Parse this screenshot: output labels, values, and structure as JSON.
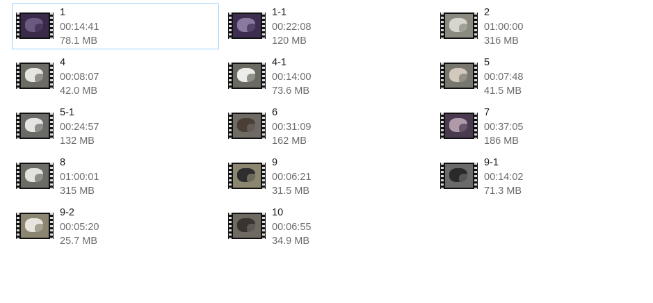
{
  "items": [
    {
      "name": "1",
      "duration": "00:14:41",
      "size": "78.1 MB",
      "selected": true,
      "thumb_bg": "#3a2a4a",
      "thumb_fg": "#6b5a7f"
    },
    {
      "name": "1-1",
      "duration": "00:22:08",
      "size": "120 MB",
      "selected": false,
      "thumb_bg": "#3d2d4f",
      "thumb_fg": "#8a7aa0"
    },
    {
      "name": "2",
      "duration": "01:00:00",
      "size": "316 MB",
      "selected": false,
      "thumb_bg": "#8a8a80",
      "thumb_fg": "#d8d6cc"
    },
    {
      "name": "4",
      "duration": "00:08:07",
      "size": "42.0 MB",
      "selected": false,
      "thumb_bg": "#6c6c64",
      "thumb_fg": "#e6e6e0"
    },
    {
      "name": "4-1",
      "duration": "00:14:00",
      "size": "73.6 MB",
      "selected": false,
      "thumb_bg": "#6a6a62",
      "thumb_fg": "#ececea"
    },
    {
      "name": "5",
      "duration": "00:07:48",
      "size": "41.5 MB",
      "selected": false,
      "thumb_bg": "#777770",
      "thumb_fg": "#d2c9bc"
    },
    {
      "name": "5-1",
      "duration": "00:24:57",
      "size": "132 MB",
      "selected": false,
      "thumb_bg": "#6a6a66",
      "thumb_fg": "#e4e4e2"
    },
    {
      "name": "6",
      "duration": "00:31:09",
      "size": "162 MB",
      "selected": false,
      "thumb_bg": "#6e6a64",
      "thumb_fg": "#4a3f36"
    },
    {
      "name": "7",
      "duration": "00:37:05",
      "size": "186 MB",
      "selected": false,
      "thumb_bg": "#4a3a50",
      "thumb_fg": "#b09aaa"
    },
    {
      "name": "8",
      "duration": "01:00:01",
      "size": "315 MB",
      "selected": false,
      "thumb_bg": "#6c6c66",
      "thumb_fg": "#e2e2de"
    },
    {
      "name": "9",
      "duration": "00:06:21",
      "size": "31.5 MB",
      "selected": false,
      "thumb_bg": "#8a8670",
      "thumb_fg": "#2e2e2e"
    },
    {
      "name": "9-1",
      "duration": "00:14:02",
      "size": "71.3 MB",
      "selected": false,
      "thumb_bg": "#6a6a6a",
      "thumb_fg": "#2a2a2a"
    },
    {
      "name": "9-2",
      "duration": "00:05:20",
      "size": "25.7 MB",
      "selected": false,
      "thumb_bg": "#8a8672",
      "thumb_fg": "#e6e4dc"
    },
    {
      "name": "10",
      "duration": "00:06:55",
      "size": "34.9 MB",
      "selected": false,
      "thumb_bg": "#6e6a62",
      "thumb_fg": "#3a3430"
    }
  ]
}
